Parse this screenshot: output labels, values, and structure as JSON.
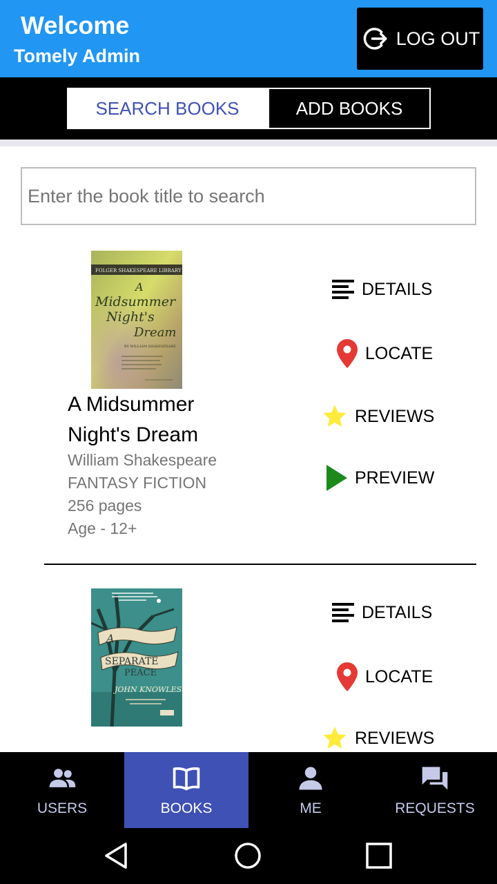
{
  "header": {
    "welcome": "Welcome",
    "user_name": "Tomely Admin",
    "logout_label": "LOG OUT"
  },
  "tabs": {
    "search_label": "SEARCH BOOKS",
    "add_label": "ADD BOOKS",
    "active": "search"
  },
  "search": {
    "placeholder": "Enter the book title to search",
    "value": ""
  },
  "books": [
    {
      "title_line1": "A Midsummer",
      "title_line2": "Night's Dream",
      "author": "William Shakespeare",
      "genre": "FANTASY FICTION",
      "pages": "256 pages",
      "age": "Age - 12+",
      "cover": {
        "publisher": "FOLGER SHAKESPEARE LIBRARY",
        "text_a": "A",
        "text_midsummer": "Midsummer",
        "text_nights": "Night's",
        "text_dream": "Dream",
        "byline": "BY WILLIAM SHAKESPEARE"
      }
    },
    {
      "cover": {
        "text_a": "A",
        "text_separate": "SEPARATE",
        "text_peace": "PEACE",
        "author": "JOHN KNOWLES"
      }
    }
  ],
  "actions": {
    "details": "DETAILS",
    "locate": "LOCATE",
    "reviews": "REVIEWS",
    "preview": "PREVIEW"
  },
  "bottom_nav": {
    "items": [
      {
        "label": "USERS",
        "icon": "users-icon"
      },
      {
        "label": "BOOKS",
        "icon": "book-open-icon"
      },
      {
        "label": "ME",
        "icon": "person-icon"
      },
      {
        "label": "REQUESTS",
        "icon": "chat-icon"
      }
    ],
    "active": "BOOKS"
  },
  "colors": {
    "header_bg": "#2196F3",
    "accent": "#3F51B5",
    "locate_pin": "#E53935",
    "reviews_star": "#FFEB3B",
    "preview_play": "#1B8A1B"
  }
}
